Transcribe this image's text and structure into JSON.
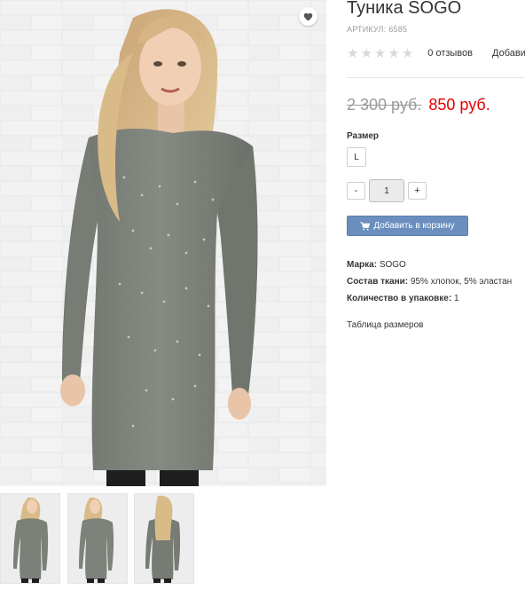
{
  "product": {
    "title": "Туника SOGO",
    "article_label": "АРТИКУЛ:",
    "article_value": "6585",
    "rating_stars": 0,
    "rating_max": 5,
    "reviews_label": "0 отзывов",
    "add_review_label": "Добавить отзыв",
    "old_price": "2 300 руб.",
    "new_price": "850 руб.",
    "size_label": "Размер",
    "size_options": [
      "L"
    ],
    "quantity": "1",
    "qty_minus": "-",
    "qty_plus": "+",
    "add_to_cart_label": "Добавить в корзину",
    "properties": [
      {
        "key": "Марка:",
        "value": "SOGO"
      },
      {
        "key": "Состав ткани:",
        "value": "95% хлопок, 5% эластан"
      },
      {
        "key": "Количество в упаковке:",
        "value": "1"
      }
    ],
    "size_table_link": "Таблица размеров"
  },
  "icons": {
    "wishlist": "heart-icon",
    "cart": "cart-icon",
    "star": "star-icon"
  },
  "colors": {
    "price_new": "#e60000",
    "price_old": "#9a9a9a",
    "button": "#6a8fbf",
    "star_empty": "#d9d9d9",
    "tunic": "#7b8078",
    "wall": "#e9e9e9"
  }
}
